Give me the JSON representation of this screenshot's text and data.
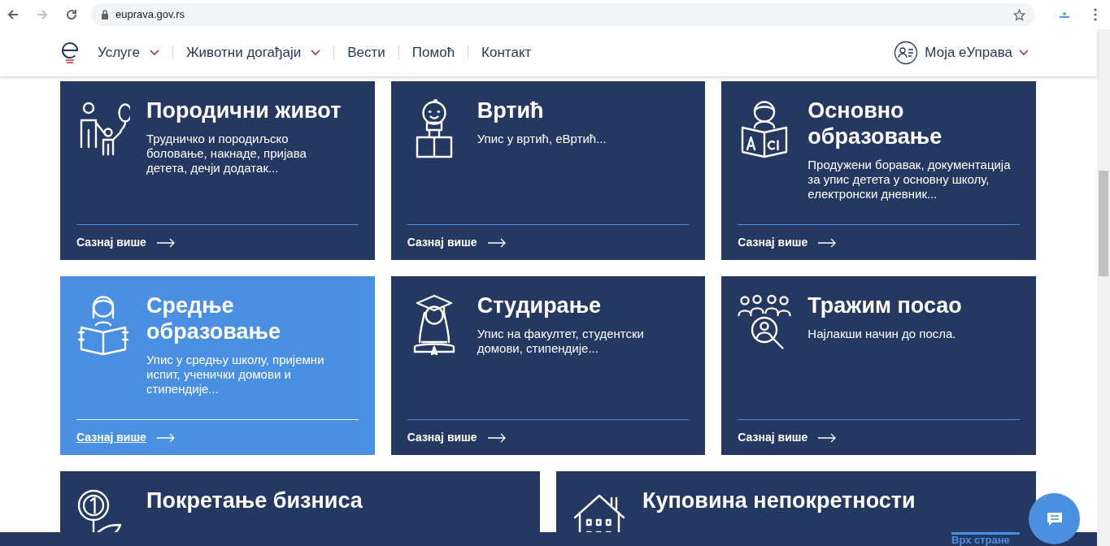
{
  "browser": {
    "url": "euprava.gov.rs"
  },
  "nav": {
    "items": [
      {
        "label": "Услуге",
        "dropdown": true
      },
      {
        "label": "Животни догађаји",
        "dropdown": true
      },
      {
        "label": "Вести",
        "dropdown": false
      },
      {
        "label": "Помоћ",
        "dropdown": false
      },
      {
        "label": "Контакт",
        "dropdown": false
      }
    ],
    "account": {
      "label": "Моја еУправа",
      "dropdown": true
    }
  },
  "cards": [
    {
      "title": "Породични живот",
      "description": "Трудничко и породиљско боловање, накнаде, пријава детета, дечји додатак...",
      "link": "Сазнај више",
      "selected": false
    },
    {
      "title": "Вртић",
      "description": "Упис у вртић, еВртић...",
      "link": "Сазнај више",
      "selected": false
    },
    {
      "title": "Основно образовање",
      "description": "Продужени боравак, документација за упис детета у основну школу, електронски дневник...",
      "link": "Сазнај више",
      "selected": false
    },
    {
      "title": "Средње образовање",
      "description": "Упис у средњу школу, пријемни испит, ученички домови и стипендије...",
      "link": "Сазнај више",
      "selected": true
    },
    {
      "title": "Студирање",
      "description": "Упис на факултет, студентски домови, стипендије...",
      "link": "Сазнај више",
      "selected": false
    },
    {
      "title": "Тражим посао",
      "description": "Најлакши начин до посла.",
      "link": "Сазнај више",
      "selected": false
    }
  ],
  "bottom_cards": [
    {
      "title": "Покретање бизниса"
    },
    {
      "title": "Куповина непокретности"
    }
  ],
  "back_to_top": "Врх стране"
}
